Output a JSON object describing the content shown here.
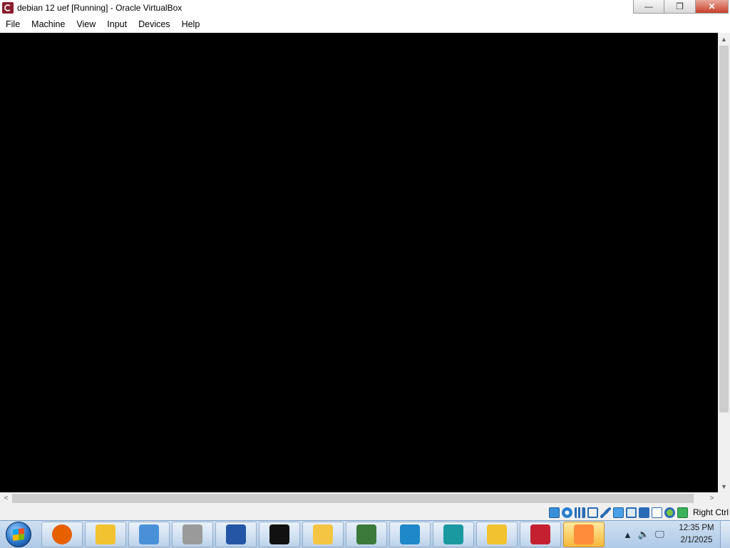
{
  "window": {
    "title": "debian 12 uef [Running] - Oracle VirtualBox",
    "controls": {
      "minimize": "—",
      "restore": "❐",
      "close": "✕"
    }
  },
  "menu": [
    "File",
    "Machine",
    "View",
    "Input",
    "Devices",
    "Help"
  ],
  "scroll_arrows": {
    "up": "▲",
    "down": "▼",
    "left": "<",
    "right": ">"
  },
  "status_bar": {
    "icons": [
      "storage-icon",
      "optical-disk-icon",
      "audio-icon",
      "network-icon",
      "usb-icon",
      "shared-folders-icon",
      "display-icon",
      "video-capture-icon",
      "virtualization-icon",
      "mouse-integration-icon",
      "keyboard-icon"
    ],
    "host_key": "Right Ctrl"
  },
  "taskbar": {
    "apps": [
      {
        "name": "firefox",
        "color": "#e66000"
      },
      {
        "name": "bee-app",
        "color": "#f2c230"
      },
      {
        "name": "computer-app",
        "color": "#4a90d9"
      },
      {
        "name": "settings-app",
        "color": "#9a9a9a"
      },
      {
        "name": "powershell",
        "color": "#2456a6"
      },
      {
        "name": "command-prompt",
        "color": "#111111"
      },
      {
        "name": "file-explorer",
        "color": "#f4c542"
      },
      {
        "name": "pond-app",
        "color": "#3c7a3c"
      },
      {
        "name": "virtualbox-app",
        "color": "#1e88c8"
      },
      {
        "name": "vs-app",
        "color": "#1a9aa0"
      },
      {
        "name": "arrows-app",
        "color": "#f2c230"
      },
      {
        "name": "x64-debugger",
        "color": "#c42030"
      },
      {
        "name": "virtualbox-running",
        "color": "#ff8c3a"
      }
    ],
    "tray_icons": {
      "chevron": "▲",
      "volume": "🔈",
      "network": "🖵"
    },
    "clock": {
      "time": "12:35 PM",
      "date": "2/1/2025"
    }
  }
}
